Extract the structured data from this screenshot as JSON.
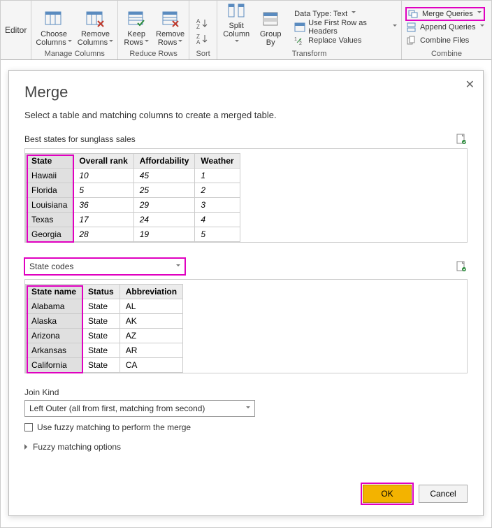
{
  "ribbon": {
    "editor_label": "Editor",
    "manage_columns": {
      "group": "Manage Columns",
      "choose": "Choose\nColumns",
      "remove": "Remove\nColumns"
    },
    "reduce_rows": {
      "group": "Reduce Rows",
      "keep": "Keep\nRows",
      "remove": "Remove\nRows"
    },
    "sort": {
      "group": "Sort"
    },
    "transform": {
      "group": "Transform",
      "split": "Split\nColumn",
      "groupby": "Group\nBy",
      "datatype": "Data Type: Text",
      "firstrow": "Use First Row as Headers",
      "replace": "Replace Values"
    },
    "combine": {
      "group": "Combine",
      "merge": "Merge Queries",
      "append": "Append Queries",
      "combine": "Combine Files"
    }
  },
  "dialog": {
    "title": "Merge",
    "subtitle": "Select a table and matching columns to create a merged table.",
    "table1_caption": "Best states for sunglass sales",
    "table1": {
      "columns": [
        "State",
        "Overall rank",
        "Affordability",
        "Weather"
      ],
      "rows": [
        [
          "Hawaii",
          "10",
          "45",
          "1"
        ],
        [
          "Florida",
          "5",
          "25",
          "2"
        ],
        [
          "Louisiana",
          "36",
          "29",
          "3"
        ],
        [
          "Texas",
          "17",
          "24",
          "4"
        ],
        [
          "Georgia",
          "28",
          "19",
          "5"
        ]
      ]
    },
    "second_table_select": "State codes",
    "table2": {
      "columns": [
        "State name",
        "Status",
        "Abbreviation"
      ],
      "rows": [
        [
          "Alabama",
          "State",
          "AL"
        ],
        [
          "Alaska",
          "State",
          "AK"
        ],
        [
          "Arizona",
          "State",
          "AZ"
        ],
        [
          "Arkansas",
          "State",
          "AR"
        ],
        [
          "California",
          "State",
          "CA"
        ]
      ]
    },
    "join_kind_label": "Join Kind",
    "join_kind_value": "Left Outer (all from first, matching from second)",
    "fuzzy_checkbox": "Use fuzzy matching to perform the merge",
    "fuzzy_expander": "Fuzzy matching options",
    "ok": "OK",
    "cancel": "Cancel"
  }
}
